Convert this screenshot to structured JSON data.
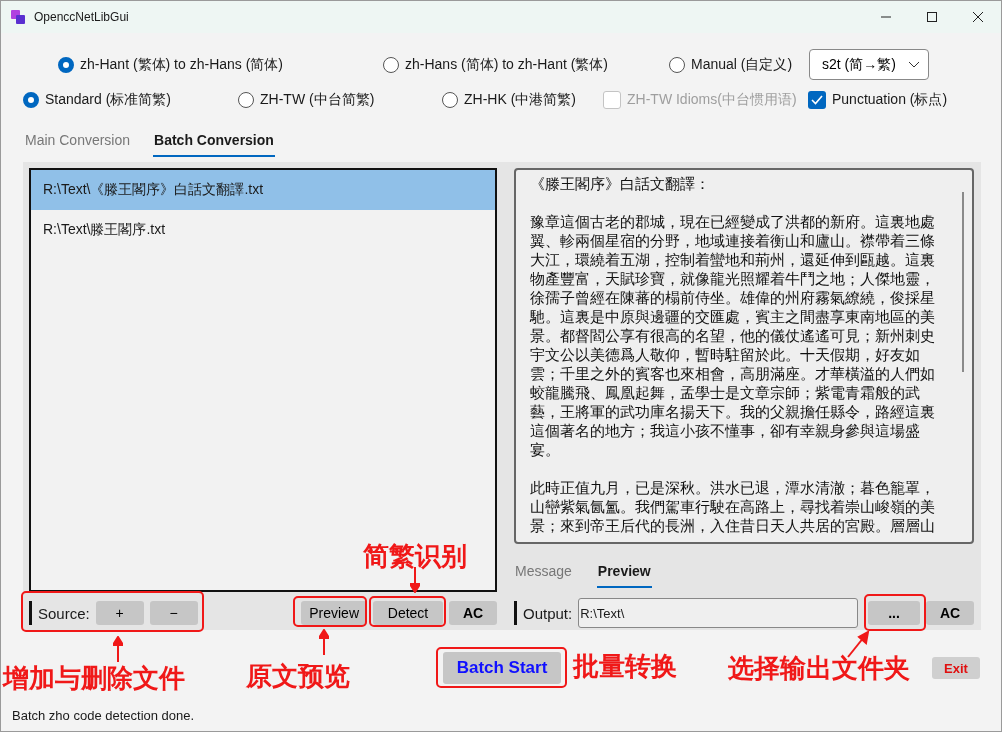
{
  "window": {
    "title": "OpenccNetLibGui"
  },
  "conversion_modes": [
    {
      "label": "zh-Hant (繁体) to zh-Hans (简体)",
      "selected": true
    },
    {
      "label": "zh-Hans (简体) to zh-Hant (繁体)",
      "selected": false
    },
    {
      "label": "Manual (自定义)",
      "selected": false
    }
  ],
  "config_dropdown": {
    "value": "s2t (简→繁)"
  },
  "variants": [
    {
      "label": "Standard (标准简繁)",
      "selected": true
    },
    {
      "label": "ZH-TW (中台简繁)",
      "selected": false
    },
    {
      "label": "ZH-HK (中港简繁)",
      "selected": false
    }
  ],
  "options": [
    {
      "label": "ZH-TW Idioms(中台惯用语)",
      "checked": false,
      "disabled": true
    },
    {
      "label": "Punctuation (标点)",
      "checked": true,
      "disabled": false
    }
  ],
  "tabs": [
    {
      "label": "Main Conversion",
      "selected": false
    },
    {
      "label": "Batch Conversion",
      "selected": true
    }
  ],
  "source_files": [
    {
      "path": "R:\\Text\\《滕王閣序》白話文翻譯.txt",
      "selected": true
    },
    {
      "path": "R:\\Text\\滕王閣序.txt",
      "selected": false
    }
  ],
  "preview_text": [
    [
      "《滕王閣序》白話文翻譯："
    ],
    [
      "豫章這個古老的郡城，現在已經變成了洪都的新府。這裏地處",
      "翼、軫兩個星宿的分野，地域連接着衡山和廬山。襟帶着三條",
      "大江，環繞着五湖，控制着蠻地和荊州，還延伸到甌越。這裏",
      "物產豐富，天賦珍寶，就像龍光照耀着牛鬥之地；人傑地靈，",
      "徐孺子曾經在陳蕃的榻前侍坐。雄偉的州府霧氣繚繞，俊採星",
      "馳。這裏是中原與邊疆的交匯處，賓主之間盡享東南地區的美",
      "景。都督閻公享有很高的名望，他的儀仗遙遙可見；新州刺史",
      "宇文公以美德爲人敬仰，暫時駐留於此。十天假期，好友如",
      "雲；千里之外的賓客也來相會，高朋滿座。才華橫溢的人們如",
      "蛟龍騰飛、鳳凰起舞，孟學士是文章宗師；紫電青霜般的武",
      "藝，王將軍的武功庫名揚天下。我的父親擔任縣令，路經這裏",
      "這個著名的地方；我這小孩不懂事，卻有幸親身參與這場盛",
      "宴。"
    ],
    [
      "此時正值九月，已是深秋。洪水已退，潭水清澈；暮色籠罩，",
      "山巒紫氣氤氳。我們駕車行駛在高路上，尋找着崇山峻嶺的美",
      "景；來到帝王后代的長洲，入住昔日天人共居的宮殿。層層山"
    ]
  ],
  "preview_tabs": [
    {
      "label": "Message",
      "selected": false
    },
    {
      "label": "Preview",
      "selected": true
    }
  ],
  "source_toolbar": {
    "label": "Source:",
    "add": "+",
    "remove": "−",
    "preview": "Preview",
    "detect": "Detect",
    "clear": "AC"
  },
  "output": {
    "label": "Output:",
    "value": "R:\\Text\\",
    "browse": "...",
    "clear": "AC"
  },
  "batch_start": "Batch Start",
  "exit": "Exit",
  "status": "Batch zho code detection done.",
  "annotations": [
    "简繁识别",
    "增加与删除文件",
    "原文预览",
    "批量转换",
    "选择输出文件夹"
  ]
}
